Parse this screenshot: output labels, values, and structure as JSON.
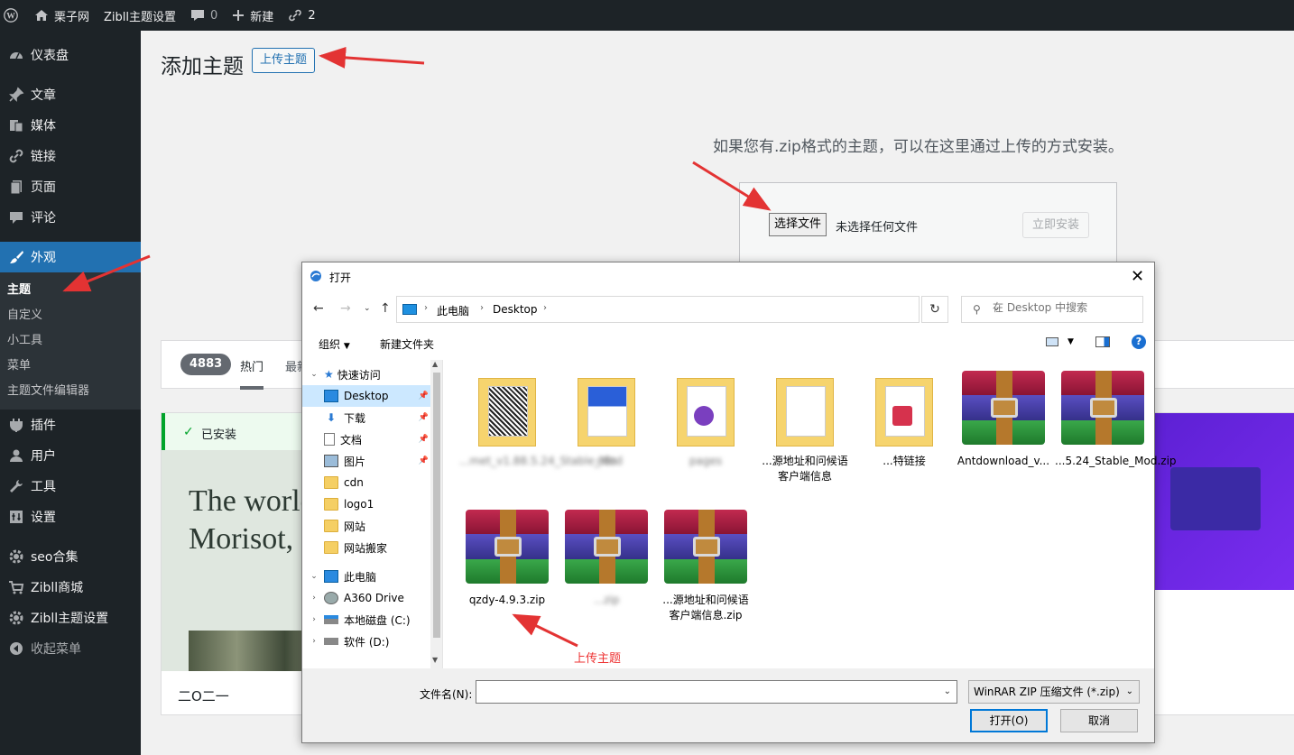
{
  "adminbar": {
    "site_name": "栗子网",
    "theme_settings": "Zibll主题设置",
    "comments_count": "0",
    "new_label": "新建",
    "links_count": "2"
  },
  "sidebar": {
    "items": [
      {
        "label": "仪表盘",
        "icon": "dashboard-icon"
      },
      {
        "label": "文章",
        "icon": "pin-icon"
      },
      {
        "label": "媒体",
        "icon": "media-icon"
      },
      {
        "label": "链接",
        "icon": "link-icon"
      },
      {
        "label": "页面",
        "icon": "page-icon"
      },
      {
        "label": "评论",
        "icon": "comment-icon"
      },
      {
        "label": "外观",
        "icon": "brush-icon"
      },
      {
        "label": "插件",
        "icon": "plugin-icon"
      },
      {
        "label": "用户",
        "icon": "user-icon"
      },
      {
        "label": "工具",
        "icon": "wrench-icon"
      },
      {
        "label": "设置",
        "icon": "settings-icon"
      },
      {
        "label": "seo合集",
        "icon": "gear-icon"
      },
      {
        "label": "Zibll商城",
        "icon": "cart-icon"
      },
      {
        "label": "Zibll主题设置",
        "icon": "gear-icon"
      },
      {
        "label": "收起菜单",
        "icon": "collapse-icon"
      }
    ],
    "submenu": [
      "主题",
      "自定义",
      "小工具",
      "菜单",
      "主题文件编辑器"
    ]
  },
  "main": {
    "title": "添加主题",
    "upload_button": "上传主题",
    "upload_desc": "如果您有.zip格式的主题，可以在这里通过上传的方式安装。",
    "choose_file": "选择文件",
    "no_file": "未选择任何文件",
    "install_now": "立即安装",
    "count": "4883",
    "tab_hot": "热门",
    "tab_new": "最新",
    "installed": "已安装",
    "theme_preview_text": "The world Morisot, French p",
    "theme_name": "二O二一"
  },
  "dialog": {
    "title": "打开",
    "crumbs": [
      "此电脑",
      "Desktop"
    ],
    "search_placeholder": "在 Desktop 中搜索",
    "organize": "组织",
    "new_folder": "新建文件夹",
    "tree": [
      {
        "label": "快速访问",
        "type": "star"
      },
      {
        "label": "Desktop",
        "type": "desktop"
      },
      {
        "label": "下载",
        "type": "download"
      },
      {
        "label": "文档",
        "type": "doc"
      },
      {
        "label": "图片",
        "type": "picture"
      },
      {
        "label": "cdn",
        "type": "folder"
      },
      {
        "label": "logo1",
        "type": "folder"
      },
      {
        "label": "网站",
        "type": "folder"
      },
      {
        "label": "网站搬家",
        "type": "folder"
      },
      {
        "label": "此电脑",
        "type": "pc"
      },
      {
        "label": "A360 Drive",
        "type": "drive"
      },
      {
        "label": "本地磁盘 (C:)",
        "type": "disk"
      },
      {
        "label": "软件 (D:)",
        "type": "disk"
      }
    ],
    "files": [
      {
        "name": "...met_v1.88.5.24_Stable_Mod",
        "kind": "folder",
        "blur": true
      },
      {
        "name": "cdn",
        "kind": "folder",
        "blur": true
      },
      {
        "name": "pages",
        "kind": "folder",
        "blur": true
      },
      {
        "name": "...源地址和问候语客户端信息",
        "kind": "folder",
        "blur": false
      },
      {
        "name": "...特链接",
        "kind": "folder",
        "blur": false
      },
      {
        "name": "Antdownload_v...",
        "kind": "rar",
        "blur": false
      },
      {
        "name": "...5.24_Stable_Mod.zip",
        "kind": "rar",
        "blur": false
      },
      {
        "name": "qzdy-4.9.3.zip",
        "kind": "rar",
        "blur": false
      },
      {
        "name": "...zip",
        "kind": "rar",
        "blur": true
      },
      {
        "name": "...源地址和问候语客户端信息.zip",
        "kind": "rar",
        "blur": false
      }
    ],
    "filename_label": "文件名(N):",
    "filter": "WinRAR ZIP 压缩文件 (*.zip)",
    "open": "打开(O)",
    "cancel": "取消"
  },
  "annotation": "上传主题",
  "colors": {
    "accent": "#2271b1",
    "annotation": "#e33333",
    "dark": "#1d2327"
  }
}
